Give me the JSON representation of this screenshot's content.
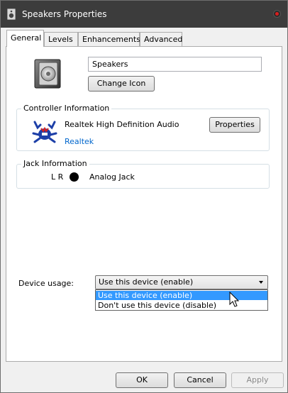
{
  "window": {
    "title": "Speakers Properties"
  },
  "tabs": [
    {
      "label": "General",
      "active": true
    },
    {
      "label": "Levels",
      "active": false
    },
    {
      "label": "Enhancements",
      "active": false
    },
    {
      "label": "Advanced",
      "active": false
    }
  ],
  "general": {
    "device_name": "Speakers",
    "change_icon_label": "Change Icon",
    "controller": {
      "group_label": "Controller Information",
      "name": "Realtek High Definition Audio",
      "vendor_link": "Realtek",
      "properties_label": "Properties"
    },
    "jack": {
      "group_label": "Jack Information",
      "channels": "L R",
      "type": "Analog Jack",
      "dot_color": "#000000"
    },
    "device_usage": {
      "label": "Device usage:",
      "selected": "Use this device (enable)",
      "options": [
        {
          "label": "Use this device (enable)",
          "highlighted": true
        },
        {
          "label": "Don't use this device (disable)",
          "highlighted": false
        }
      ]
    }
  },
  "footer": {
    "ok_label": "OK",
    "cancel_label": "Cancel",
    "apply_label": "Apply"
  },
  "colors": {
    "titlebar": "#3c3c3c",
    "selection": "#3399ff",
    "link": "#0066cc",
    "close_accent": "#d81e1e"
  }
}
